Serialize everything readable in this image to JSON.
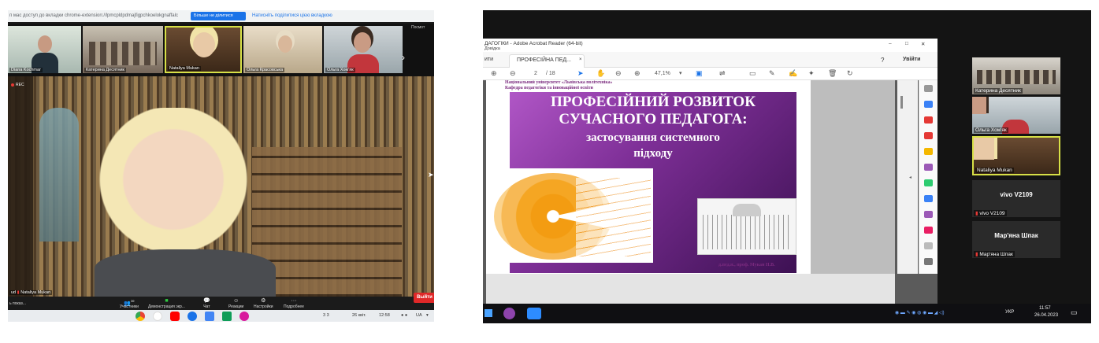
{
  "left": {
    "banner": {
      "info_text": "п мас доступ до вкладки chrome-extension://lpmcpldpdmajfigpchkoelokgnaffalc",
      "button_label": "Більше не ділитися",
      "link_label": "Натисніть поділитися цією вкладкою",
      "view_label": "Посмот"
    },
    "gallery": [
      {
        "name": "Diana Kochmar"
      },
      {
        "name": "Катерина Десятник"
      },
      {
        "name": "Nataliya Mukan"
      },
      {
        "name": "Ольга Красовська"
      },
      {
        "name": "Ольга Хом'як"
      }
    ],
    "rec_label": "REC",
    "main_speaker_name": "Nataliya Mukan",
    "main_speaker_prefix": "ud",
    "toolbar": {
      "show_label": "ь показ...",
      "participants_label": "Участники",
      "participants_count": "39",
      "screen_share_label": "Демонстрация экр...",
      "chat_label": "Чат",
      "reactions_label": "Реакции",
      "settings_label": "Настройки",
      "more_label": "Подробнее",
      "leave_label": "Выйти"
    },
    "taskbar": {
      "language_badge": "3 3",
      "date": "26 квіт.",
      "time": "12:58",
      "locale": "UA"
    }
  },
  "right": {
    "window_title": "ДАГОГІКИ - Adobe Acrobat Reader (64-bit)",
    "menu_label": "Довідка",
    "tabs": {
      "home_label": "ити",
      "doc_tab_label": "ПРОФЕСІЙНА ПЕД...",
      "sign_in_label": "Увійти"
    },
    "toolbar": {
      "page_current": "2",
      "page_total": "/ 18",
      "zoom": "47,1%"
    },
    "slide": {
      "header_line1": "Національний університет «Львівська політехніка»",
      "header_line2": "Кафедра педагогіки та інноваційної освіти",
      "title_line1": "ПРОФЕСІЙНИЙ РОЗВИТОК",
      "title_line2": "СУЧАСНОГО ПЕДАГОГА:",
      "subtitle_line1": "застосування системного",
      "subtitle_line2": "підходу",
      "author": "д.пед.н., проф. Мукан Н.В."
    },
    "participants": [
      {
        "name": "Катерина Десятник",
        "type": "video"
      },
      {
        "name": "Ольга Хом'як",
        "type": "video"
      },
      {
        "name": "Nataliya Mukan",
        "type": "video",
        "active": true
      },
      {
        "name": "vivo V2109",
        "type": "nametile"
      },
      {
        "name": "Мар'яна Шпак",
        "type": "nametile"
      }
    ],
    "taskbar": {
      "language": "УКР",
      "time": "11:57",
      "date": "26.04.2023"
    }
  },
  "colors": {
    "zoom_blue": "#1a73e8",
    "leave_red": "#e02828",
    "active_speaker_border": "#d7e047",
    "slide_purple": "#7e2f97"
  }
}
